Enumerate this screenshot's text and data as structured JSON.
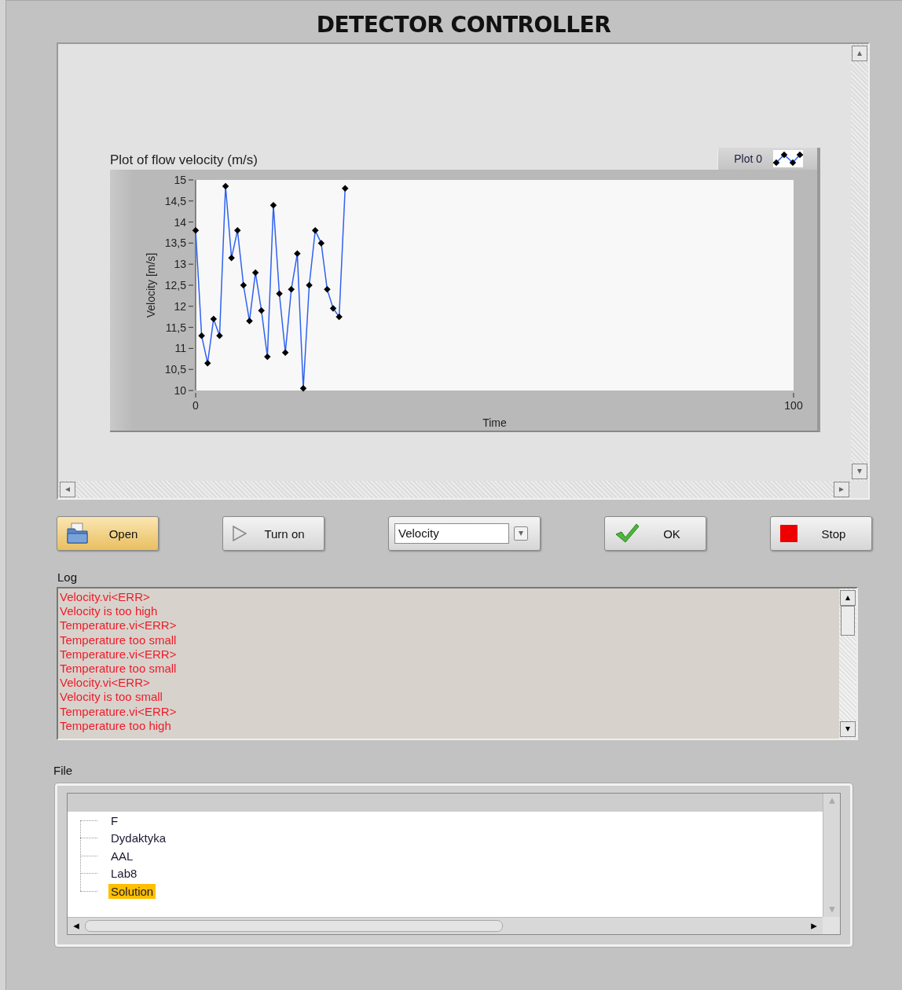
{
  "title": "DETECTOR CONTROLLER",
  "graph": {
    "title": "Plot of flow velocity (m/s)",
    "chart_data": {
      "type": "line",
      "xlabel": "Time",
      "ylabel": "Velocity [m/s]",
      "x": [
        0,
        1,
        2,
        3,
        4,
        5,
        6,
        7,
        8,
        9,
        10,
        11,
        12,
        13,
        14,
        15,
        16,
        17,
        18,
        19,
        20,
        21,
        22,
        23,
        24,
        25
      ],
      "series": [
        {
          "name": "Plot 0",
          "color": "#2f62f0",
          "marker": "diamond",
          "values": [
            13.8,
            11.3,
            10.65,
            11.7,
            11.3,
            14.85,
            13.15,
            13.8,
            12.5,
            11.65,
            12.8,
            11.9,
            10.8,
            14.4,
            12.3,
            10.9,
            12.4,
            13.25,
            10.05,
            12.5,
            13.8,
            13.5,
            12.4,
            11.95,
            11.75,
            14.8
          ]
        }
      ],
      "xlim": [
        0,
        100
      ],
      "ylim": [
        10,
        15
      ],
      "xticks": [
        0,
        100
      ],
      "yticks": [
        10,
        {
          "value": 10.5,
          "label": "10,5"
        },
        11,
        {
          "value": 11.5,
          "label": "11,5"
        },
        12,
        {
          "value": 12.5,
          "label": "12,5"
        },
        13,
        {
          "value": 13.5,
          "label": "13,5"
        },
        14,
        {
          "value": 14.5,
          "label": "14,5"
        },
        15
      ]
    }
  },
  "controls": [
    {
      "kind": "open",
      "label": "Open"
    },
    {
      "kind": "play",
      "label": "Turn on"
    },
    {
      "kind": "select",
      "value": "Velocity"
    },
    {
      "kind": "ok",
      "label": "OK"
    },
    {
      "kind": "stop",
      "label": "Stop"
    }
  ],
  "log": {
    "label": "Log",
    "lines": [
      "Velocity.vi<ERR>",
      "Velocity is too high",
      "Temperature.vi<ERR>",
      "Temperature too small",
      "Temperature.vi<ERR>",
      "Temperature too small",
      "Velocity.vi<ERR>",
      "Velocity is too small",
      "Temperature.vi<ERR>",
      "Temperature too high"
    ]
  },
  "file": {
    "label": "File",
    "items": [
      {
        "label": "F",
        "selected": false
      },
      {
        "label": "Dydaktyka",
        "selected": false
      },
      {
        "label": "AAL",
        "selected": false
      },
      {
        "label": "Lab8",
        "selected": false
      },
      {
        "label": "Solution",
        "selected": true
      }
    ]
  }
}
